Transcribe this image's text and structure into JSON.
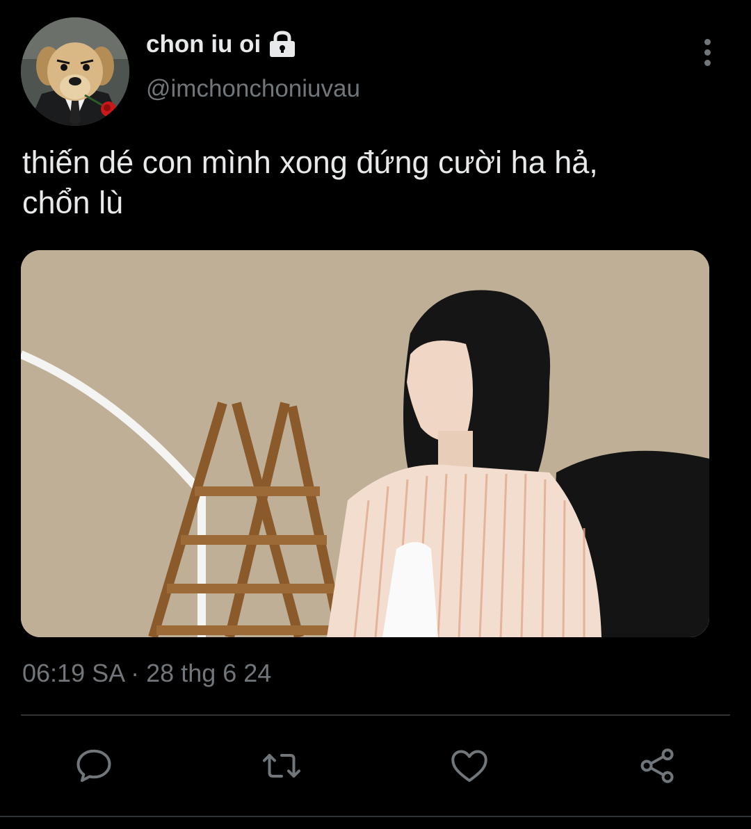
{
  "user": {
    "display_name": "chon iu oi",
    "handle": "@imchonchoniuvau",
    "protected_icon": "lock-icon",
    "avatar": "dog-in-suit-with-rose"
  },
  "tweet": {
    "text": "thiến dé con mình xong đứng cười ha hả,\nchổn lù",
    "media_description": "photo",
    "time": "06:19 SA",
    "separator": " · ",
    "date": "28 thg 6 24"
  },
  "actions": {
    "icons": [
      "reply-icon",
      "retweet-icon",
      "like-icon",
      "share-icon"
    ]
  },
  "colors": {
    "background": "#000000",
    "primary_text": "#e7e9ea",
    "secondary_text": "#71767b",
    "divider": "#2f3336"
  }
}
